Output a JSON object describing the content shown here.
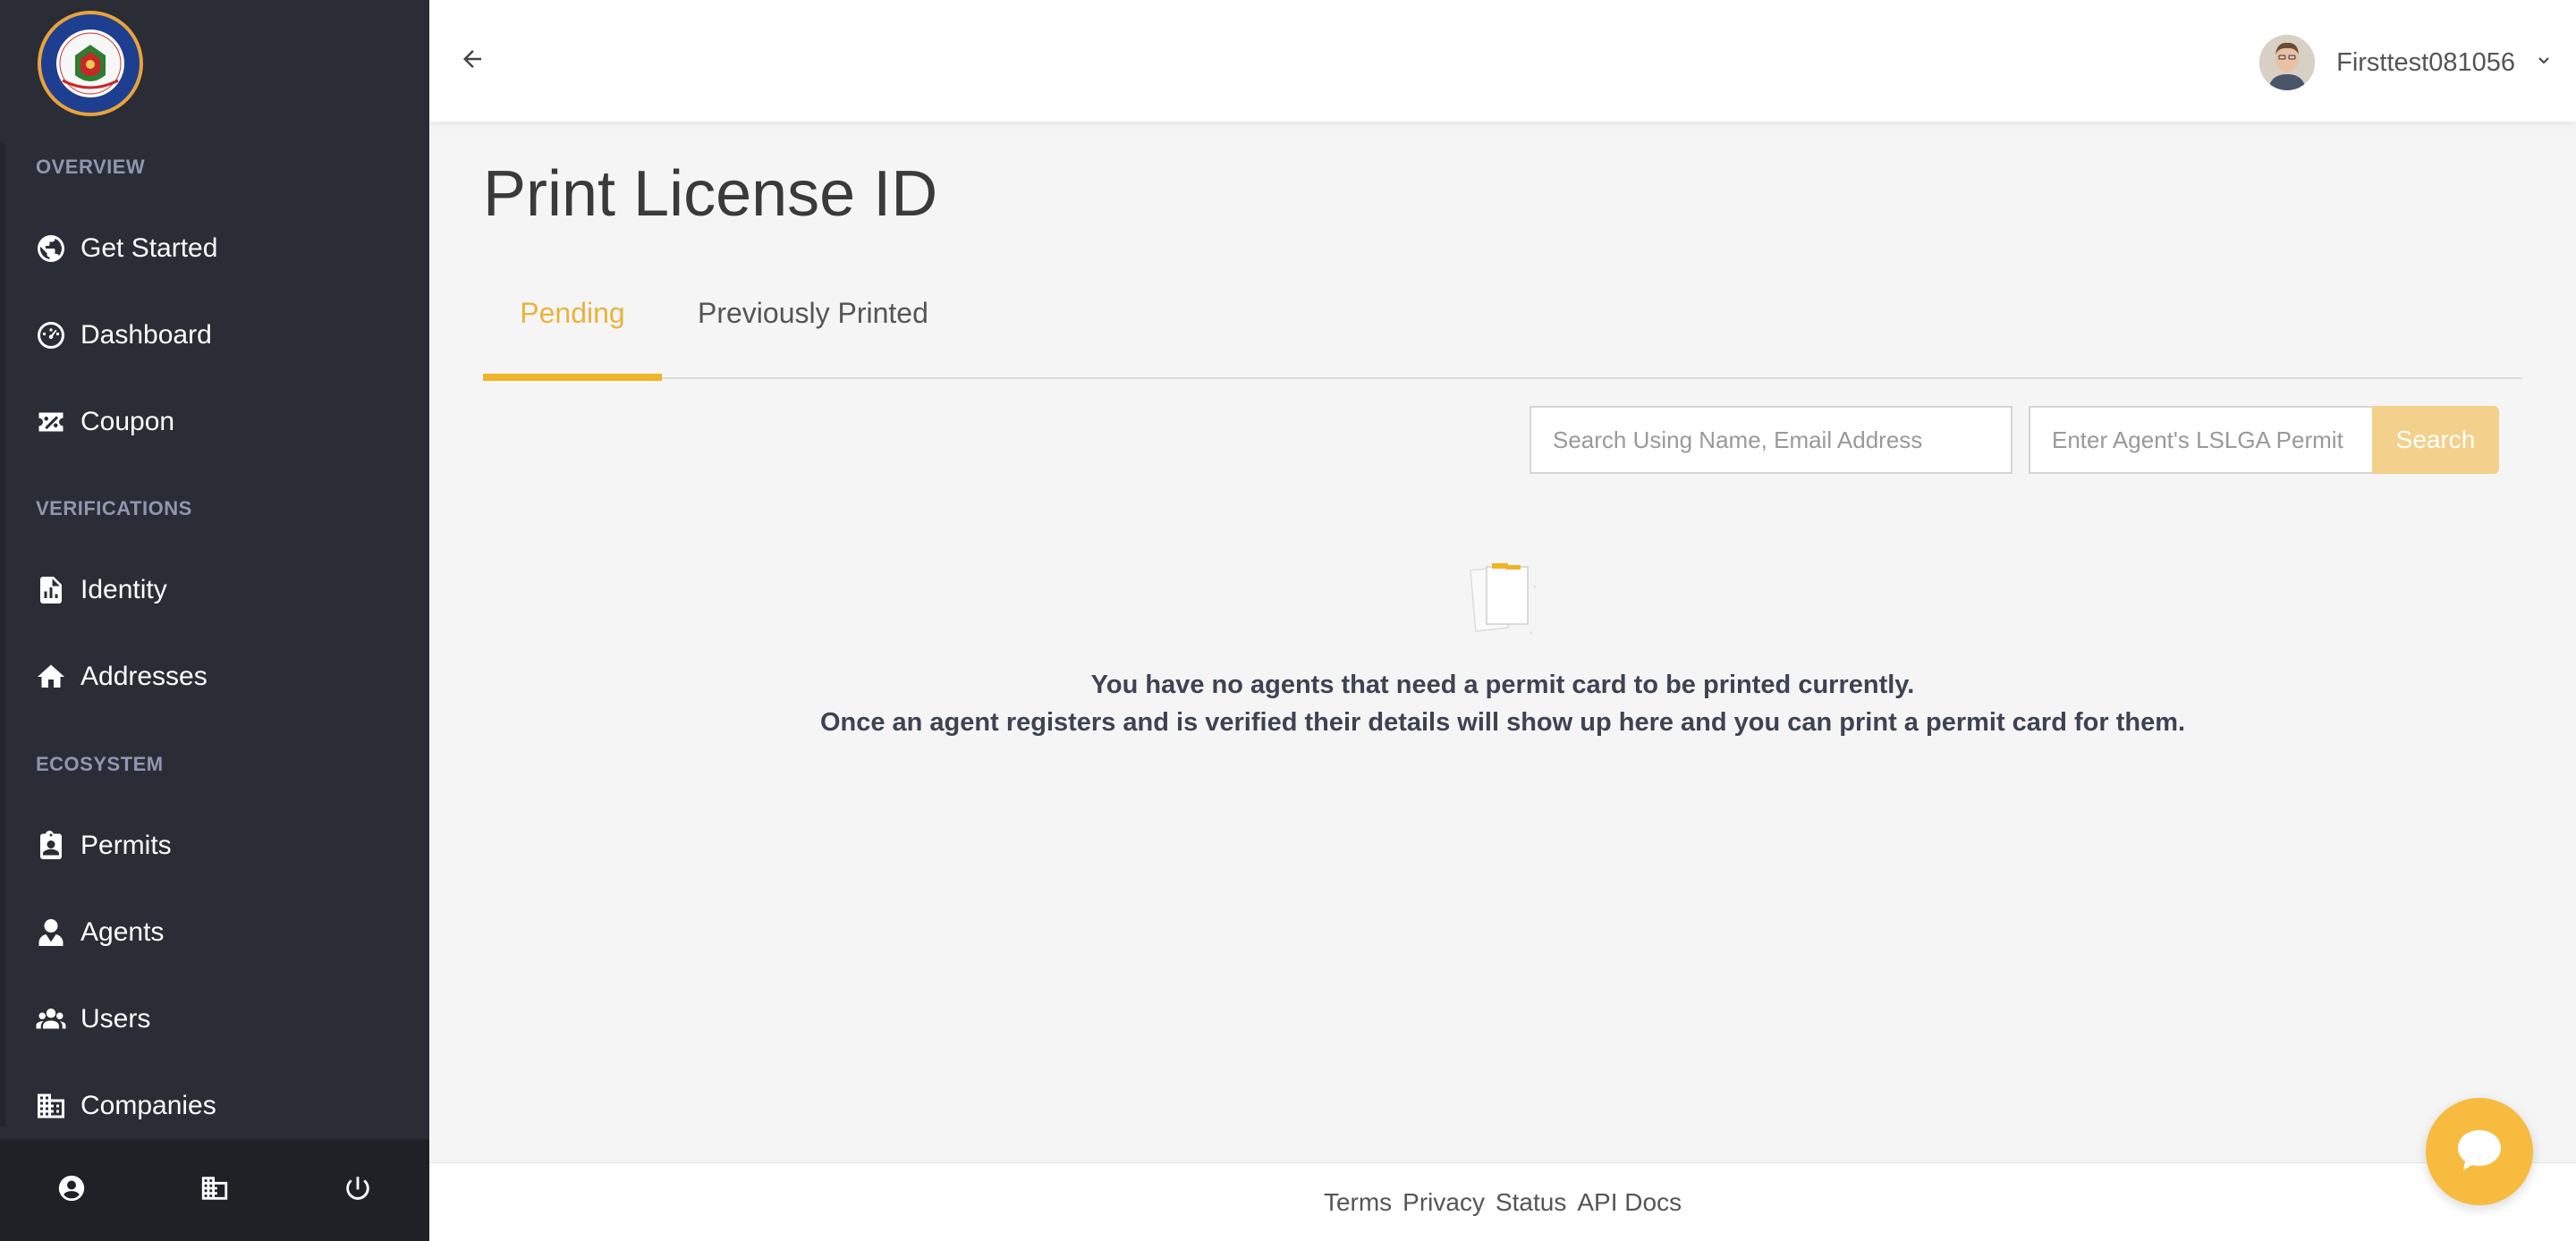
{
  "sidebar": {
    "logo_text": "LAGOS STATE LOTTERIES AND GAMING AUTHORITY",
    "sections": [
      {
        "label": "OVERVIEW"
      },
      {
        "label": "VERIFICATIONS"
      },
      {
        "label": "ECOSYSTEM"
      }
    ],
    "items": [
      {
        "label": "Get Started",
        "icon": "globe-icon"
      },
      {
        "label": "Dashboard",
        "icon": "dashboard-gauge-icon"
      },
      {
        "label": "Coupon",
        "icon": "coupon-icon"
      },
      {
        "label": "Identity",
        "icon": "file-chart-icon"
      },
      {
        "label": "Addresses",
        "icon": "home-icon"
      },
      {
        "label": "Permits",
        "icon": "id-badge-icon"
      },
      {
        "label": "Agents",
        "icon": "user-tie-icon"
      },
      {
        "label": "Users",
        "icon": "users-icon"
      },
      {
        "label": "Companies",
        "icon": "building-icon"
      }
    ],
    "footer_icons": [
      "user-circle-icon",
      "building-icon",
      "power-icon"
    ]
  },
  "header": {
    "username": "Firsttest081056"
  },
  "main": {
    "title": "Print License ID",
    "tabs": [
      {
        "label": "Pending",
        "active": true
      },
      {
        "label": "Previously Printed",
        "active": false
      }
    ],
    "search": {
      "name_placeholder": "Search Using Name, Email Address",
      "permit_placeholder": "Enter Agent's LSLGA Permit",
      "button_label": "Search"
    },
    "empty_state": {
      "line1": "You have no agents that need a permit card to be printed currently.",
      "line2": "Once an agent registers and is verified their details will show up here and you can print a permit card for them."
    }
  },
  "footer": {
    "links": [
      "Terms",
      "Privacy",
      "Status",
      "API Docs"
    ]
  },
  "colors": {
    "sidebar_bg": "#2a2d35",
    "accent": "#f0b429",
    "search_button": "#f3d08c",
    "chat_button": "#f7bb3f"
  }
}
